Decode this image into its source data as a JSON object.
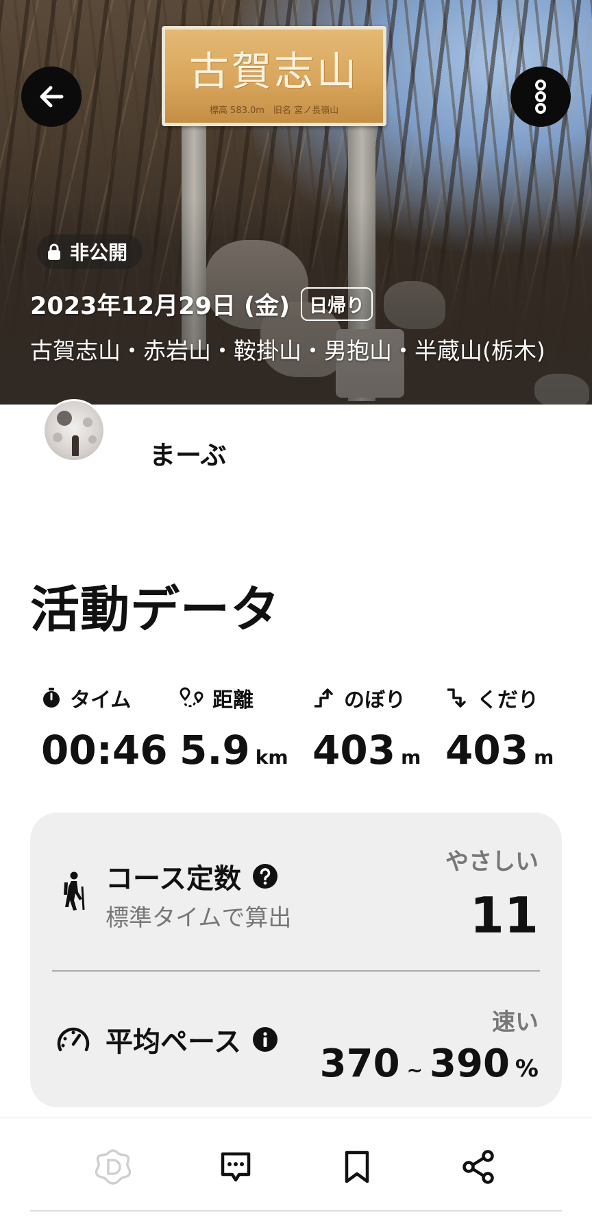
{
  "hero": {
    "sign_title": "古賀志山",
    "sign_sub": "標高 583.0m　旧名 宮ノ長嶺山",
    "privacy_label": "非公開",
    "date": "2023年12月29日 (金)",
    "trip_type": "日帰り",
    "mountains": "古賀志山・赤岩山・鞍掛山・男抱山・半蔵山(栃木)"
  },
  "user": {
    "name": "まーぶ"
  },
  "activity": {
    "title": "活動データ",
    "stats": [
      {
        "label": "タイム",
        "value": "00:46",
        "unit": "",
        "icon": "stopwatch-icon"
      },
      {
        "label": "距離",
        "value": "5.9",
        "unit": "km",
        "icon": "route-icon"
      },
      {
        "label": "のぼり",
        "value": "403",
        "unit": "m",
        "icon": "ascent-icon"
      },
      {
        "label": "くだり",
        "value": "403",
        "unit": "m",
        "icon": "descent-icon"
      }
    ]
  },
  "course": {
    "title": "コース定数",
    "subtitle": "標準タイムで算出",
    "difficulty": "やさしい",
    "value": "11"
  },
  "pace": {
    "title": "平均ペース",
    "speed_label": "速い",
    "min": "370",
    "separator": "~",
    "max": "390",
    "unit": "%"
  },
  "colors": {
    "card_bg": "#efefef",
    "muted_text": "#777777",
    "accent_dark": "#0b0b0b"
  }
}
